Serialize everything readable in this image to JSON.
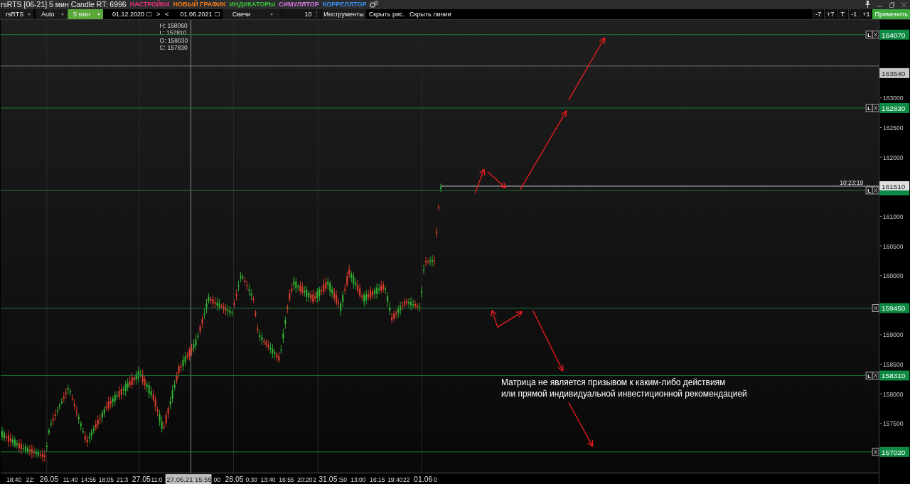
{
  "window": {
    "title": "rsRTS [06-21] 5 мин Candle RT: 6996"
  },
  "menu": [
    {
      "label": "НАСТРОЙКИ",
      "color": "#e8327c"
    },
    {
      "label": "НОВЫЙ ГРАФИК",
      "color": "#f07a1a"
    },
    {
      "label": "ИНДИКАТОРЫ",
      "color": "#3cc03c"
    },
    {
      "label": "СИМУЛЯТОР",
      "color": "#d878e0"
    },
    {
      "label": "КОРРЕЛЯТОР",
      "color": "#3a90f0"
    }
  ],
  "toolbar": {
    "symbol": "rsRTS",
    "scale": "Auto",
    "timeframe": "5 мин",
    "date_from": "01.12.2020",
    "next": ">",
    "prev": "<",
    "date_to": "01.06.2021",
    "chart_type": "Свечи",
    "count": "10",
    "buttons": [
      "Инструменты",
      "Скрыть рис.",
      "Скрыть линии"
    ],
    "shift_buttons": [
      "-7",
      "+7",
      "T",
      "-1",
      "+1"
    ],
    "apply": "Применить"
  },
  "ohlc": [
    "H: 158060",
    "L: 157810",
    "O: 158030",
    "C: 157830"
  ],
  "levels": [
    {
      "price": "164070",
      "kind": "green",
      "lock_label": "L"
    },
    {
      "price": "163540",
      "kind": "gray"
    },
    {
      "price": "162830",
      "kind": "green",
      "lock_label": "L"
    },
    {
      "price": "161510",
      "kind": "current",
      "time": "10:23:19",
      "lock_label": "L"
    },
    {
      "price": "159450",
      "kind": "green"
    },
    {
      "price": "158310",
      "kind": "green",
      "lock_label": "L"
    },
    {
      "price": "157020",
      "kind": "green"
    }
  ],
  "price_ticks": [
    "163000",
    "162500",
    "162000",
    "161000",
    "160500",
    "160000",
    "159000",
    "158500",
    "158000",
    "157500"
  ],
  "note": [
    "Матрица не является призывом к каким-либо действиям",
    "или прямой индивидуальной инвестиционной рекомендацией"
  ],
  "time_labels": [
    {
      "text": "18:40",
      "cursor": false
    },
    {
      "text": "22:",
      "cursor": false
    },
    {
      "text": "26.05",
      "cursor": false
    },
    {
      "text": "11:40",
      "cursor": false
    },
    {
      "text": "14:55",
      "cursor": false
    },
    {
      "text": "18:05",
      "cursor": false
    },
    {
      "text": "21:3",
      "cursor": false
    },
    {
      "text": "27.05",
      "cursor": false
    },
    {
      "text": "11:0",
      "cursor": false
    },
    {
      "text": "27.05.21 15:55",
      "cursor": true
    },
    {
      "text": "00",
      "cursor": false
    },
    {
      "text": "28.05",
      "cursor": false
    },
    {
      "text": "0:30",
      "cursor": false
    },
    {
      "text": "13:40",
      "cursor": false
    },
    {
      "text": "16:55",
      "cursor": false
    },
    {
      "text": "20:20",
      "cursor": false
    },
    {
      "text": "2",
      "cursor": false
    },
    {
      "text": "31.05",
      "cursor": false
    },
    {
      "text": ":50",
      "cursor": false
    },
    {
      "text": "13:00",
      "cursor": false
    },
    {
      "text": "16:15",
      "cursor": false
    },
    {
      "text": "19:40",
      "cursor": false
    },
    {
      "text": "22",
      "cursor": false
    },
    {
      "text": "01.06",
      "cursor": false
    },
    {
      "text": "0",
      "cursor": false
    }
  ]
}
